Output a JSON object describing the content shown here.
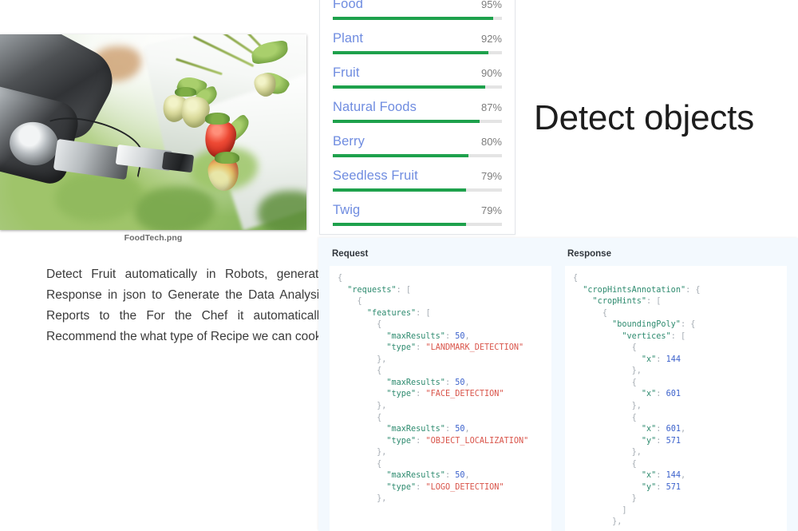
{
  "document": {
    "image_caption": "FoodTech.png",
    "body_paragraph": "Detect Fruit automatically in Robots, generate Response in json to Generate the Data Analysis Reports to the For the Chef it automatically Recommend the what type of Recipe we can cook",
    "photo_alt": "Robotic arm gripper picking ripe strawberries on a hydroponic greenhouse rack"
  },
  "heading": {
    "detect_objects": "Detect objects"
  },
  "labels": {
    "accent_bar_color": "#1ea14c",
    "track_color": "#e4e4e4",
    "label_text_color": "#6f8ce0",
    "score_text_color": "#7d7d7d",
    "items": [
      {
        "name": "Food",
        "score": "95%",
        "value": 95
      },
      {
        "name": "Plant",
        "score": "92%",
        "value": 92
      },
      {
        "name": "Fruit",
        "score": "90%",
        "value": 90
      },
      {
        "name": "Natural Foods",
        "score": "87%",
        "value": 87
      },
      {
        "name": "Berry",
        "score": "80%",
        "value": 80
      },
      {
        "name": "Seedless Fruit",
        "score": "79%",
        "value": 79
      },
      {
        "name": "Twig",
        "score": "79%",
        "value": 79
      }
    ]
  },
  "api_panel": {
    "background_color": "#f3f9fe",
    "request": {
      "title": "Request",
      "code": "{\n  \"requests\": [\n    {\n      \"features\": [\n        {\n          \"maxResults\": 50,\n          \"type\": \"LANDMARK_DETECTION\"\n        },\n        {\n          \"maxResults\": 50,\n          \"type\": \"FACE_DETECTION\"\n        },\n        {\n          \"maxResults\": 50,\n          \"type\": \"OBJECT_LOCALIZATION\"\n        },\n        {\n          \"maxResults\": 50,\n          \"type\": \"LOGO_DETECTION\"\n        },"
    },
    "response": {
      "title": "Response",
      "code": "{\n  \"cropHintsAnnotation\": {\n    \"cropHints\": [\n      {\n        \"boundingPoly\": {\n          \"vertices\": [\n            {\n              \"x\": 144\n            },\n            {\n              \"x\": 601\n            },\n            {\n              \"x\": 601,\n              \"y\": 571\n            },\n            {\n              \"x\": 144,\n              \"y\": 571\n            }\n          ]\n        },"
    }
  }
}
